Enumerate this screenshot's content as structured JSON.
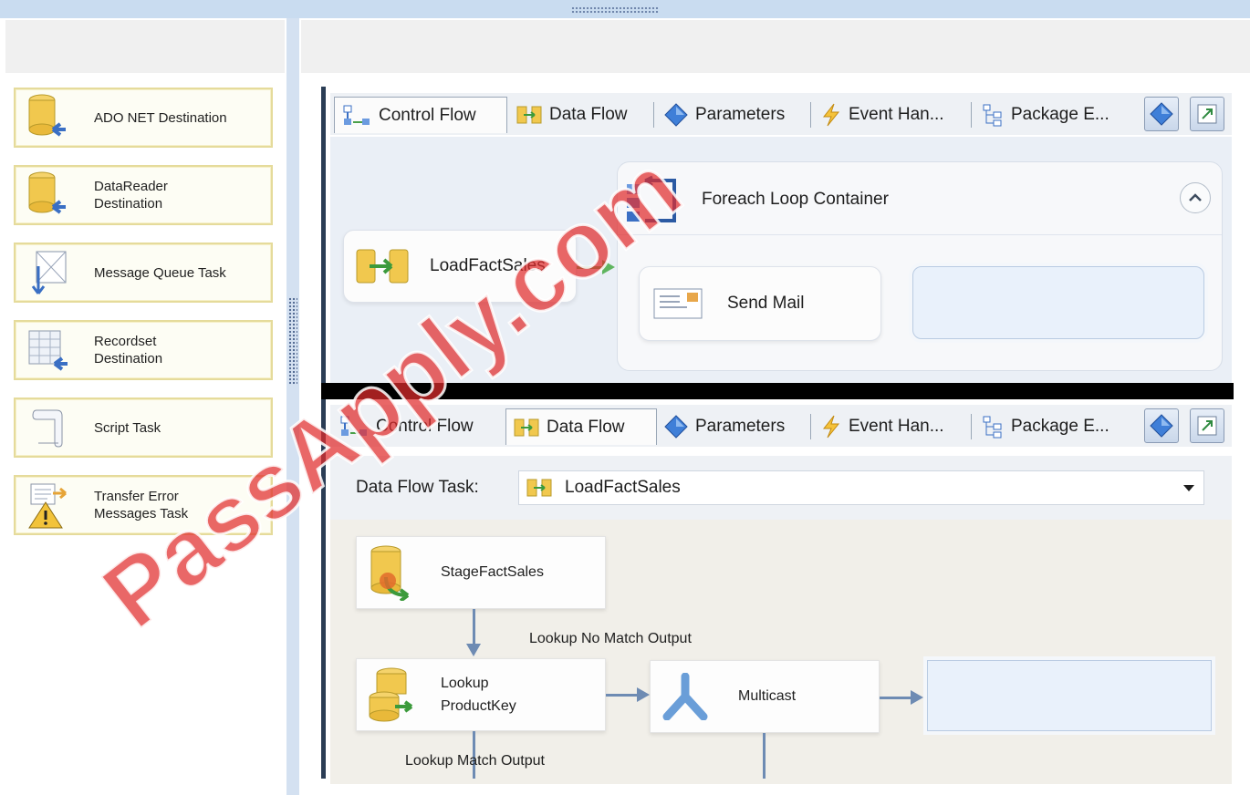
{
  "toolbox": {
    "items": [
      {
        "label": "ADO NET Destination",
        "icon": "ado-net-destination-icon"
      },
      {
        "label": "DataReader\nDestination",
        "icon": "datareader-destination-icon"
      },
      {
        "label": "Message Queue Task",
        "icon": "message-queue-icon"
      },
      {
        "label": "Recordset\nDestination",
        "icon": "recordset-destination-icon"
      },
      {
        "label": "Script Task",
        "icon": "script-icon"
      },
      {
        "label": "Transfer Error\nMessages Task",
        "icon": "transfer-error-icon"
      }
    ]
  },
  "designer_tabs": [
    "Control Flow",
    "Data Flow",
    "Parameters",
    "Event Han...",
    "Package E..."
  ],
  "control_flow_view": {
    "active_tab": "Control Flow",
    "task": "LoadFactSales",
    "container_title": "Foreach Loop Container",
    "inner_task": "Send Mail"
  },
  "data_flow_view": {
    "active_tab": "Data Flow",
    "task_label": "Data Flow Task:",
    "task_value": "LoadFactSales",
    "source": "StageFactSales",
    "lookup": "Lookup\nProductKey",
    "multicast": "Multicast",
    "no_match_label": "Lookup No Match Output",
    "match_label": "Lookup Match Output"
  },
  "watermark": "PassApply.com",
  "colors": {
    "accent": "#2b3d55",
    "connector": "#6e8bb3",
    "toolbox_border": "#e5db9b",
    "watermark": "#e02d2d"
  }
}
